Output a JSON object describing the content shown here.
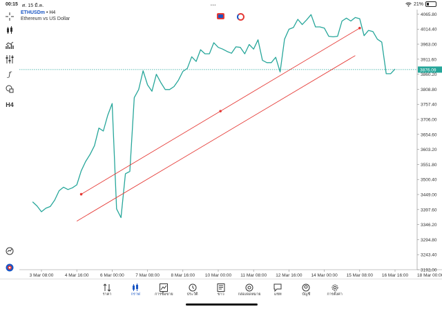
{
  "status": {
    "time": "00:15",
    "date": "ศ. 15 มี.ค.",
    "battery": "21%"
  },
  "symbol": {
    "ticker": "ETHUSDm",
    "separator": " • ",
    "timeframe": "H4",
    "description": "Ethereum vs US Dollar"
  },
  "toolbar": {
    "timeframe_label": "H4"
  },
  "colors": {
    "candle_line": "#26a69a",
    "trendline": "#e53935",
    "price_tag": "#26a69a",
    "accent": "#1a56c4"
  },
  "chart_data": {
    "type": "line",
    "series": [
      {
        "values": [
          3424,
          3410,
          3390,
          3402,
          3408,
          3430,
          3462,
          3474,
          3466,
          3472,
          3482,
          3530,
          3562,
          3586,
          3616,
          3676,
          3666,
          3720,
          3760,
          3400,
          3370,
          3520,
          3528,
          3780,
          3808,
          3872,
          3824,
          3802,
          3860,
          3832,
          3808,
          3808,
          3818,
          3840,
          3870,
          3880,
          3920,
          3904,
          3944,
          3930,
          3930,
          3968,
          3952,
          3946,
          3938,
          3932,
          3954,
          3952,
          3930,
          3962,
          3946,
          3978,
          3908,
          3900,
          3900,
          3918,
          3868,
          3980,
          4014,
          4020,
          4048,
          4030,
          4046,
          4064,
          4022,
          4022,
          4018,
          3990,
          3988,
          3990,
          4042,
          4052,
          4042,
          4054,
          4050,
          3992,
          4010,
          4006,
          3980,
          3970,
          3862,
          3862,
          3878
        ]
      }
    ],
    "trendlines": [
      {
        "start_date": "4 Mar 20:00",
        "start_price": 3450,
        "end_date": "15 Mar 08:00",
        "end_price": 4018
      },
      {
        "start_date": "4 Mar 16:00",
        "start_price": 3358,
        "end_date": "15 Mar 04:00",
        "end_price": 3924
      }
    ],
    "x_tick_labels": [
      "3 Mar 08:00",
      "4 Mar 16:00",
      "6 Mar 00:00",
      "7 Mar 08:00",
      "8 Mar 16:00",
      "10 Mar 00:00",
      "11 Mar 08:00",
      "12 Mar 16:00",
      "14 Mar 00:00",
      "15 Mar 08:00",
      "16 Mar 16:00",
      "18 Mar 00:00"
    ],
    "y_tick_labels": [
      "4065.80",
      "4014.40",
      "3963.00",
      "3911.60",
      "3860.20",
      "3808.80",
      "3757.40",
      "3706.00",
      "3654.60",
      "3603.20",
      "3551.80",
      "3500.40",
      "3449.00",
      "3397.60",
      "3346.20",
      "3294.80",
      "3243.40",
      "3192.00"
    ],
    "current_price": "3876.09",
    "ylim": [
      3192.0,
      4081.0
    ]
  },
  "tabs": [
    {
      "label": "ราคา",
      "icon": "arrows-icon"
    },
    {
      "label": "กราฟ",
      "icon": "candles-icon",
      "active": true
    },
    {
      "label": "การซื้อขาย",
      "icon": "trade-chart-icon"
    },
    {
      "label": "ประวัติ",
      "icon": "history-icon"
    },
    {
      "label": "ข่าว",
      "icon": "news-icon"
    },
    {
      "label": "กล่องจดหมาย",
      "icon": "at-icon"
    },
    {
      "label": "แชท",
      "icon": "chat-icon"
    },
    {
      "label": "บัญชี",
      "icon": "account-icon"
    },
    {
      "label": "การตั้งค่า",
      "icon": "settings-icon"
    }
  ]
}
